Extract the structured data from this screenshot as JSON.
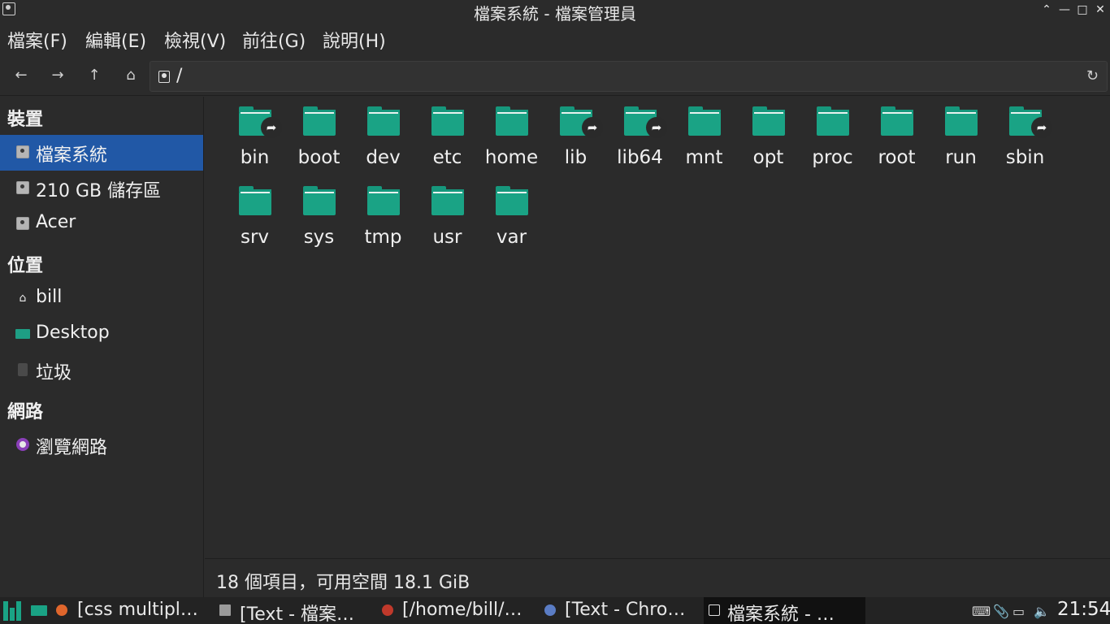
{
  "window": {
    "title": "檔案系統 - 檔案管理員"
  },
  "menubar": {
    "items": [
      "檔案(F)",
      "編輯(E)",
      "檢視(V)",
      "前往(G)",
      "說明(H)"
    ]
  },
  "toolbar": {
    "path": "/"
  },
  "sidebar": {
    "sections": [
      {
        "header": "裝置",
        "items": [
          {
            "label": "檔案系統",
            "icon": "drive-icon",
            "active": true
          },
          {
            "label": "210 GB 儲存區",
            "icon": "drive-icon",
            "active": false
          },
          {
            "label": "Acer",
            "icon": "drive-icon",
            "active": false
          }
        ]
      },
      {
        "header": "位置",
        "items": [
          {
            "label": "bill",
            "icon": "home-icon",
            "active": false
          },
          {
            "label": "Desktop",
            "icon": "desktop-icon",
            "active": false
          },
          {
            "label": "垃圾",
            "icon": "trash-icon",
            "active": false
          }
        ]
      },
      {
        "header": "網路",
        "items": [
          {
            "label": "瀏覽網路",
            "icon": "network-icon",
            "active": false
          }
        ]
      }
    ]
  },
  "files": [
    {
      "name": "bin",
      "symlink": true
    },
    {
      "name": "boot",
      "symlink": false
    },
    {
      "name": "dev",
      "symlink": false
    },
    {
      "name": "etc",
      "symlink": false
    },
    {
      "name": "home",
      "symlink": false
    },
    {
      "name": "lib",
      "symlink": true
    },
    {
      "name": "lib64",
      "symlink": true
    },
    {
      "name": "mnt",
      "symlink": false
    },
    {
      "name": "opt",
      "symlink": false
    },
    {
      "name": "proc",
      "symlink": false
    },
    {
      "name": "root",
      "symlink": false
    },
    {
      "name": "run",
      "symlink": false
    },
    {
      "name": "sbin",
      "symlink": true
    },
    {
      "name": "srv",
      "symlink": false
    },
    {
      "name": "sys",
      "symlink": false
    },
    {
      "name": "tmp",
      "symlink": false
    },
    {
      "name": "usr",
      "symlink": false
    },
    {
      "name": "var",
      "symlink": false
    }
  ],
  "statusbar": {
    "text": "18 個項目，可用空間 18.1 GiB"
  },
  "taskbar": {
    "items": [
      {
        "label": "[css multipl…",
        "icon": "firefox-icon",
        "active": false
      },
      {
        "label": "[Text - 檔案…",
        "icon": "folder-icon",
        "active": false
      },
      {
        "label": "[/home/bill/…",
        "icon": "editor-icon",
        "active": false
      },
      {
        "label": "[Text - Chro…",
        "icon": "chromium-icon",
        "active": false
      },
      {
        "label": "檔案系統 - …",
        "icon": "drive-icon",
        "active": true
      }
    ],
    "clock": "21:54"
  },
  "colors": {
    "accent": "#2158a6",
    "folder": "#1aa385",
    "background": "#2b2b2b"
  }
}
